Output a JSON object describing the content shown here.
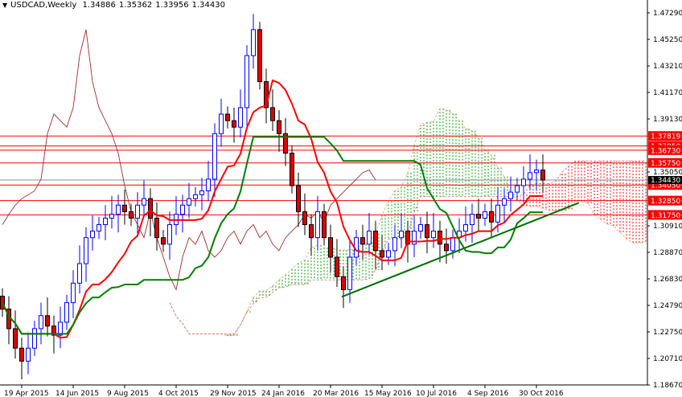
{
  "header": {
    "arrow": "▼",
    "symbol": "USDCAD,Weekly",
    "open": "1.34886",
    "high": "1.35362",
    "low": "1.33956",
    "close": "1.34430"
  },
  "colors": {
    "level": "#ff0000",
    "tenkan": "#ff0000",
    "kijun": "#008000",
    "chikou": "#a52a2a",
    "bull": "#0000ff",
    "bear": "#e00000",
    "trend": "#007000"
  },
  "chart_data": {
    "type": "candlestick",
    "title": "USDCAD,Weekly",
    "indicator": "Ichimoku Kinko Hyo (9,26,52)",
    "ylim": [
      1.1867,
      1.4729
    ],
    "y_ticks": [
      "1.47290",
      "1.45250",
      "1.43210",
      "1.41170",
      "1.39130",
      "1.35050",
      "1.30910",
      "1.28870",
      "1.26830",
      "1.24790",
      "1.22750",
      "1.20710",
      "1.18670"
    ],
    "x_ticks": [
      {
        "week": 3,
        "label": "19 Apr 2015"
      },
      {
        "week": 11,
        "label": "14 Jun 2015"
      },
      {
        "week": 19,
        "label": "9 Aug 2015"
      },
      {
        "week": 27,
        "label": "4 Oct 2015"
      },
      {
        "week": 35,
        "label": "29 Nov 2015"
      },
      {
        "week": 43,
        "label": "24 Jan 2016"
      },
      {
        "week": 51,
        "label": "20 Mar 2016"
      },
      {
        "week": 59,
        "label": "15 May 2016"
      },
      {
        "week": 67,
        "label": "10 Jul 2016"
      },
      {
        "week": 75,
        "label": "4 Sep 2016"
      },
      {
        "week": 83,
        "label": "30 Oct 2016"
      }
    ],
    "closes": [
      1.245,
      1.23,
      1.215,
      1.205,
      1.215,
      1.23,
      1.24,
      1.232,
      1.225,
      1.235,
      1.25,
      1.265,
      1.28,
      1.3,
      1.305,
      1.31,
      1.315,
      1.318,
      1.325,
      1.32,
      1.315,
      1.325,
      1.33,
      1.315,
      1.3,
      1.295,
      1.31,
      1.318,
      1.325,
      1.33,
      1.333,
      1.336,
      1.345,
      1.38,
      1.395,
      1.39,
      1.385,
      1.4,
      1.44,
      1.46,
      1.42,
      1.4,
      1.39,
      1.38,
      1.365,
      1.34,
      1.32,
      1.31,
      1.3,
      1.32,
      1.3,
      1.285,
      1.27,
      1.26,
      1.285,
      1.3,
      1.295,
      1.305,
      1.29,
      1.285,
      1.29,
      1.3,
      1.305,
      1.295,
      1.305,
      1.31,
      1.3,
      1.305,
      1.295,
      1.29,
      1.3,
      1.305,
      1.31,
      1.318,
      1.315,
      1.32,
      1.312,
      1.325,
      1.33,
      1.335,
      1.34,
      1.345,
      1.35,
      1.352,
      1.3443
    ],
    "levels": [
      {
        "value": 1.37819,
        "label": "1.37819"
      },
      {
        "value": 1.3705,
        "label": "1.37050"
      },
      {
        "value": 1.3673,
        "label": "1.36730"
      },
      {
        "value": 1.3575,
        "label": "1.35750"
      },
      {
        "value": 1.3405,
        "label": "1.34050"
      },
      {
        "value": 1.3285,
        "label": "1.32850"
      },
      {
        "value": 1.3175,
        "label": "1.31750"
      }
    ],
    "current_price": {
      "value": 1.3443,
      "label": "1.34430"
    },
    "trendline": {
      "from": {
        "week": 52.75,
        "price": 1.2545
      },
      "to": {
        "week": 89.6,
        "price": 1.3268
      }
    }
  }
}
